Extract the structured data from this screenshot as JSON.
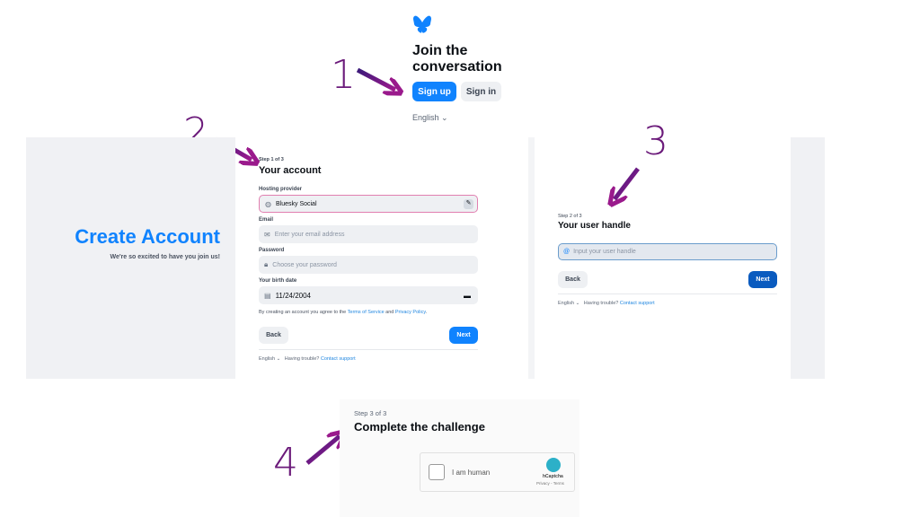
{
  "annotations": {
    "step1": "1",
    "step2": "2",
    "step3": "3",
    "step4": "4",
    "arrow_color": "#7a1f8a"
  },
  "landing": {
    "logo": "butterfly-icon",
    "title_line1": "Join the",
    "title_line2": "conversation",
    "signup": "Sign up",
    "signin": "Sign in",
    "language": "English",
    "accent": "#1083fe"
  },
  "create": {
    "heading": "Create Account",
    "subheading": "We're so excited to have you join us!",
    "step": "Step 1 of 3",
    "title": "Your account",
    "hosting_label": "Hosting provider",
    "hosting_value": "Bluesky Social",
    "email_label": "Email",
    "email_placeholder": "Enter your email address",
    "password_label": "Password",
    "password_placeholder": "Choose your password",
    "birth_label": "Your birth date",
    "birth_value": "11/24/2004",
    "terms_prefix": "By creating an account you agree to the ",
    "terms_link": "Terms of Service",
    "terms_and": " and ",
    "privacy_link": "Privacy Policy",
    "terms_suffix": ".",
    "back": "Back",
    "next": "Next",
    "language": "English",
    "trouble": "Having trouble?",
    "support": "Contact support"
  },
  "handle": {
    "step": "Step 2 of 3",
    "title": "Your user handle",
    "placeholder": "Input your user handle",
    "back": "Back",
    "next": "Next",
    "language": "English",
    "trouble": "Having trouble?",
    "support": "Contact support"
  },
  "challenge": {
    "step": "Step 3 of 3",
    "title": "Complete the challenge",
    "checkbox_label": "I am human",
    "brand": "hCaptcha",
    "privacy": "Privacy",
    "terms": "Terms"
  }
}
